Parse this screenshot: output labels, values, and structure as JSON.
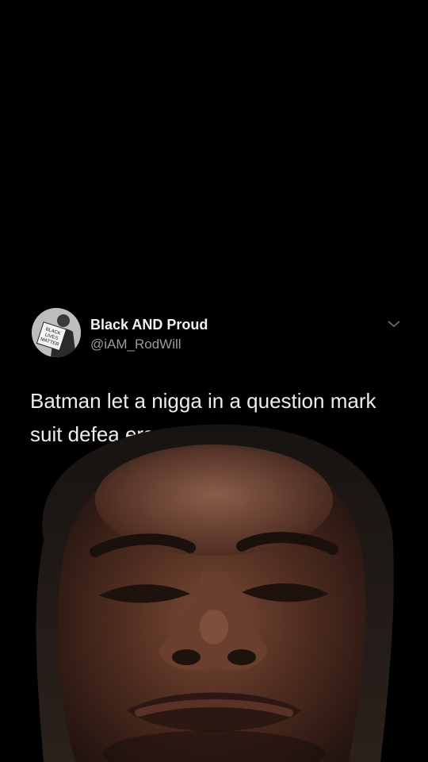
{
  "tweet": {
    "author_name": "Black AND Proud",
    "author_handle": "@iAM_RodWill",
    "text": "Batman let a nigga in a question mark suit defea                      ers",
    "avatar_sign_text": "BLACK LIVES MATTER",
    "menu_icon": "chevron-down-icon"
  },
  "overlay": {
    "subject": "person-face-cutout"
  },
  "colors": {
    "background": "#000000",
    "name": "#f2f2f2",
    "handle": "#9a9a9a",
    "text": "#ededed"
  }
}
